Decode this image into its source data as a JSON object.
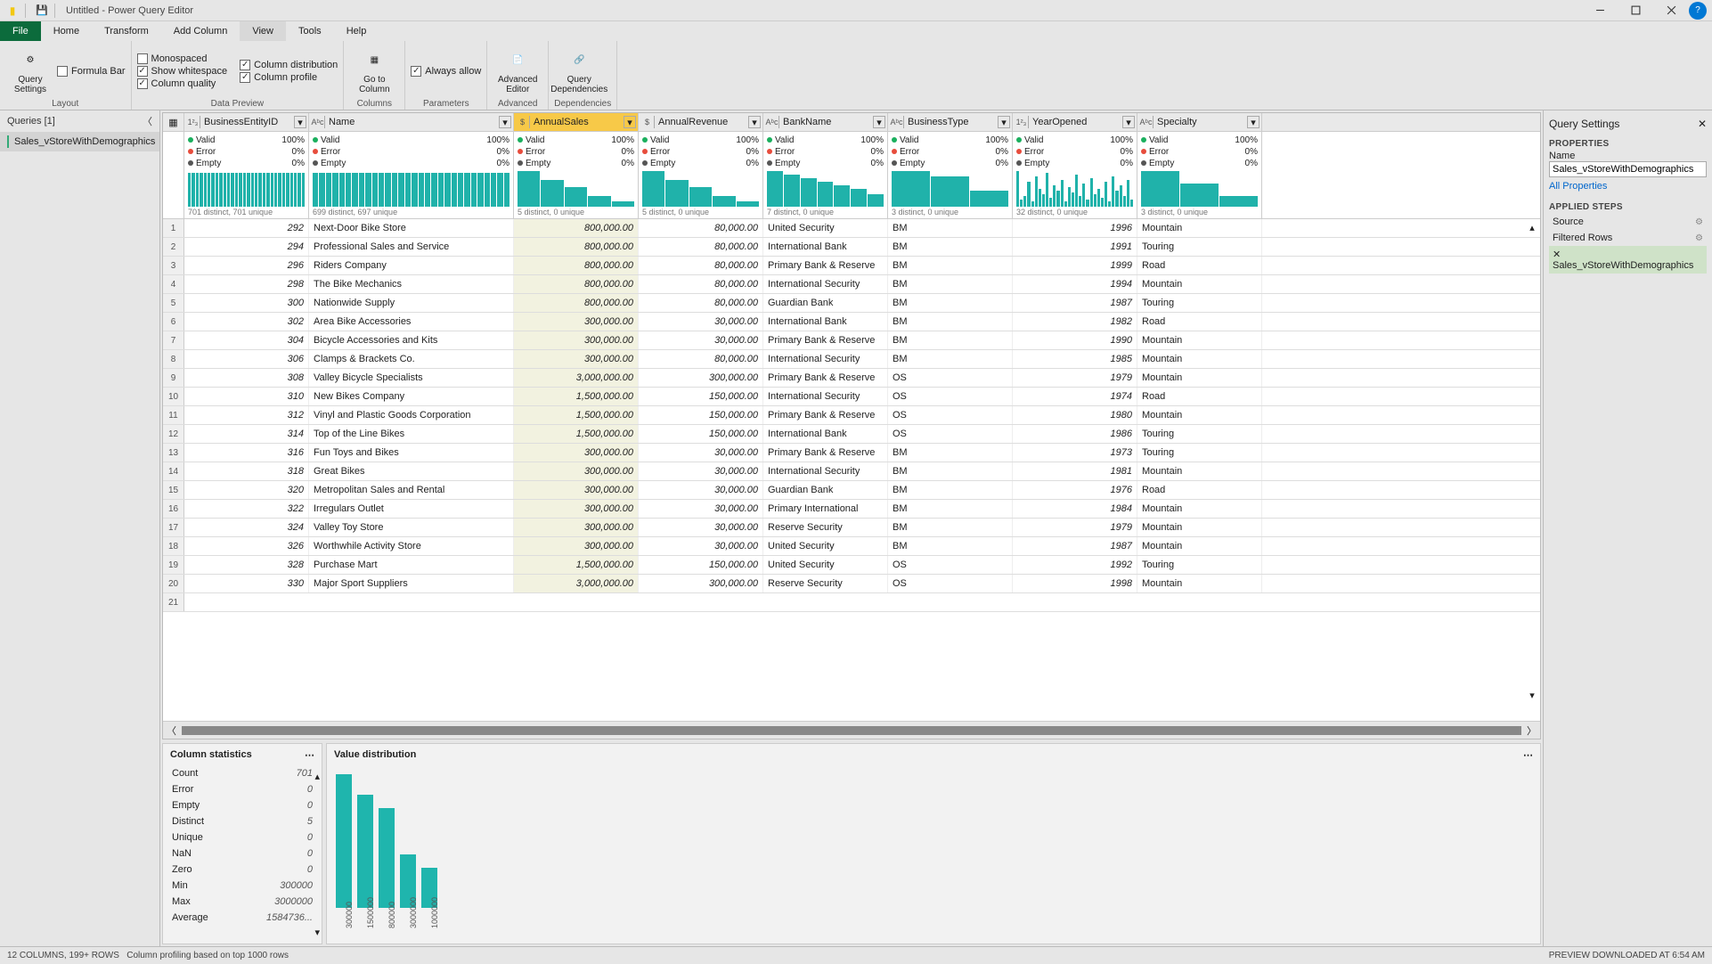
{
  "title": "Untitled - Power Query Editor",
  "menus": {
    "file": "File",
    "home": "Home",
    "transform": "Transform",
    "addcolumn": "Add Column",
    "view": "View",
    "tools": "Tools",
    "help": "Help"
  },
  "ribbon": {
    "layout": "Layout",
    "datapreview": "Data Preview",
    "columns": "Columns",
    "parameters": "Parameters",
    "advanced": "Advanced",
    "dependencies": "Dependencies",
    "querySettings": "Query\nSettings",
    "formulaBar": "Formula Bar",
    "monospaced": "Monospaced",
    "whitespace": "Show whitespace",
    "colquality": "Column quality",
    "coldist": "Column distribution",
    "colprofile": "Column profile",
    "goto": "Go to\nColumn",
    "alwaysAllow": "Always allow",
    "advEditor": "Advanced\nEditor",
    "qDeps": "Query\nDependencies"
  },
  "queriesPane": {
    "title": "Queries [1]",
    "item": "Sales_vStoreWithDemographics"
  },
  "columns": [
    {
      "name": "BusinessEntityID",
      "type": "123",
      "w": "w-beid",
      "distinct": "701 distinct, 701 unique",
      "bars": "flat"
    },
    {
      "name": "Name",
      "type": "ABC",
      "w": "w-name",
      "distinct": "699 distinct, 697 unique",
      "bars": "flat"
    },
    {
      "name": "AnnualSales",
      "type": "$",
      "w": "w-sales",
      "distinct": "5 distinct, 0 unique",
      "bars": "decay",
      "selected": true
    },
    {
      "name": "AnnualRevenue",
      "type": "$",
      "w": "w-rev",
      "distinct": "5 distinct, 0 unique",
      "bars": "decay"
    },
    {
      "name": "BankName",
      "type": "ABC",
      "w": "w-bank",
      "distinct": "7 distinct, 0 unique",
      "bars": "step"
    },
    {
      "name": "BusinessType",
      "type": "ABC",
      "w": "w-btype",
      "distinct": "3 distinct, 0 unique",
      "bars": "three"
    },
    {
      "name": "YearOpened",
      "type": "123",
      "w": "w-year",
      "distinct": "32 distinct, 0 unique",
      "bars": "varied"
    },
    {
      "name": "Specialty",
      "type": "ABC",
      "w": "w-spec",
      "distinct": "3 distinct, 0 unique",
      "bars": "three2"
    }
  ],
  "quality": {
    "valid": "Valid",
    "error": "Error",
    "empty": "Empty",
    "p100": "100%",
    "p0": "0%"
  },
  "rows": [
    {
      "id": "292",
      "name": "Next-Door Bike Store",
      "sales": "800,000.00",
      "rev": "80,000.00",
      "bank": "United Security",
      "btype": "BM",
      "year": "1996",
      "spec": "Mountain"
    },
    {
      "id": "294",
      "name": "Professional Sales and Service",
      "sales": "800,000.00",
      "rev": "80,000.00",
      "bank": "International Bank",
      "btype": "BM",
      "year": "1991",
      "spec": "Touring"
    },
    {
      "id": "296",
      "name": "Riders Company",
      "sales": "800,000.00",
      "rev": "80,000.00",
      "bank": "Primary Bank & Reserve",
      "btype": "BM",
      "year": "1999",
      "spec": "Road"
    },
    {
      "id": "298",
      "name": "The Bike Mechanics",
      "sales": "800,000.00",
      "rev": "80,000.00",
      "bank": "International Security",
      "btype": "BM",
      "year": "1994",
      "spec": "Mountain"
    },
    {
      "id": "300",
      "name": "Nationwide Supply",
      "sales": "800,000.00",
      "rev": "80,000.00",
      "bank": "Guardian Bank",
      "btype": "BM",
      "year": "1987",
      "spec": "Touring"
    },
    {
      "id": "302",
      "name": "Area Bike Accessories",
      "sales": "300,000.00",
      "rev": "30,000.00",
      "bank": "International Bank",
      "btype": "BM",
      "year": "1982",
      "spec": "Road"
    },
    {
      "id": "304",
      "name": "Bicycle Accessories and Kits",
      "sales": "300,000.00",
      "rev": "30,000.00",
      "bank": "Primary Bank & Reserve",
      "btype": "BM",
      "year": "1990",
      "spec": "Mountain"
    },
    {
      "id": "306",
      "name": "Clamps & Brackets Co.",
      "sales": "300,000.00",
      "rev": "80,000.00",
      "bank": "International Security",
      "btype": "BM",
      "year": "1985",
      "spec": "Mountain"
    },
    {
      "id": "308",
      "name": "Valley Bicycle Specialists",
      "sales": "3,000,000.00",
      "rev": "300,000.00",
      "bank": "Primary Bank & Reserve",
      "btype": "OS",
      "year": "1979",
      "spec": "Mountain"
    },
    {
      "id": "310",
      "name": "New Bikes Company",
      "sales": "1,500,000.00",
      "rev": "150,000.00",
      "bank": "International Security",
      "btype": "OS",
      "year": "1974",
      "spec": "Road"
    },
    {
      "id": "312",
      "name": "Vinyl and Plastic Goods Corporation",
      "sales": "1,500,000.00",
      "rev": "150,000.00",
      "bank": "Primary Bank & Reserve",
      "btype": "OS",
      "year": "1980",
      "spec": "Mountain"
    },
    {
      "id": "314",
      "name": "Top of the Line Bikes",
      "sales": "1,500,000.00",
      "rev": "150,000.00",
      "bank": "International Bank",
      "btype": "OS",
      "year": "1986",
      "spec": "Touring"
    },
    {
      "id": "316",
      "name": "Fun Toys and Bikes",
      "sales": "300,000.00",
      "rev": "30,000.00",
      "bank": "Primary Bank & Reserve",
      "btype": "BM",
      "year": "1973",
      "spec": "Touring"
    },
    {
      "id": "318",
      "name": "Great Bikes",
      "sales": "300,000.00",
      "rev": "30,000.00",
      "bank": "International Security",
      "btype": "BM",
      "year": "1981",
      "spec": "Mountain"
    },
    {
      "id": "320",
      "name": "Metropolitan Sales and Rental",
      "sales": "300,000.00",
      "rev": "30,000.00",
      "bank": "Guardian Bank",
      "btype": "BM",
      "year": "1976",
      "spec": "Road"
    },
    {
      "id": "322",
      "name": "Irregulars Outlet",
      "sales": "300,000.00",
      "rev": "30,000.00",
      "bank": "Primary International",
      "btype": "BM",
      "year": "1984",
      "spec": "Mountain"
    },
    {
      "id": "324",
      "name": "Valley Toy Store",
      "sales": "300,000.00",
      "rev": "30,000.00",
      "bank": "Reserve Security",
      "btype": "BM",
      "year": "1979",
      "spec": "Mountain"
    },
    {
      "id": "326",
      "name": "Worthwhile Activity Store",
      "sales": "300,000.00",
      "rev": "30,000.00",
      "bank": "United Security",
      "btype": "BM",
      "year": "1987",
      "spec": "Mountain"
    },
    {
      "id": "328",
      "name": "Purchase Mart",
      "sales": "1,500,000.00",
      "rev": "150,000.00",
      "bank": "United Security",
      "btype": "OS",
      "year": "1992",
      "spec": "Touring"
    },
    {
      "id": "330",
      "name": "Major Sport Suppliers",
      "sales": "3,000,000.00",
      "rev": "300,000.00",
      "bank": "Reserve Security",
      "btype": "OS",
      "year": "1998",
      "spec": "Mountain"
    }
  ],
  "colstats": {
    "title": "Column statistics",
    "rows": [
      [
        "Count",
        "701"
      ],
      [
        "Error",
        "0"
      ],
      [
        "Empty",
        "0"
      ],
      [
        "Distinct",
        "5"
      ],
      [
        "Unique",
        "0"
      ],
      [
        "NaN",
        "0"
      ],
      [
        "Zero",
        "0"
      ],
      [
        "Min",
        "300000"
      ],
      [
        "Max",
        "3000000"
      ],
      [
        "Average",
        "1584736..."
      ]
    ]
  },
  "valdist": {
    "title": "Value distribution"
  },
  "chart_data": {
    "type": "bar",
    "categories": [
      "300000",
      "1500000",
      "800000",
      "3000000",
      "1000000"
    ],
    "values": [
      100,
      85,
      75,
      40,
      30
    ],
    "title": "Value distribution",
    "xlabel": "",
    "ylabel": "",
    "ylim": [
      0,
      100
    ]
  },
  "qsettings": {
    "title": "Query Settings",
    "properties": "PROPERTIES",
    "nameLabel": "Name",
    "nameValue": "Sales_vStoreWithDemographics",
    "allProps": "All Properties",
    "applied": "APPLIED STEPS",
    "steps": [
      "Source",
      "Filtered Rows",
      "Sales_vStoreWithDemographics"
    ]
  },
  "status": {
    "left": "12 COLUMNS, 199+ ROWS",
    "mid": "Column profiling based on top 1000 rows",
    "right": "PREVIEW DOWNLOADED AT 6:54 AM"
  }
}
